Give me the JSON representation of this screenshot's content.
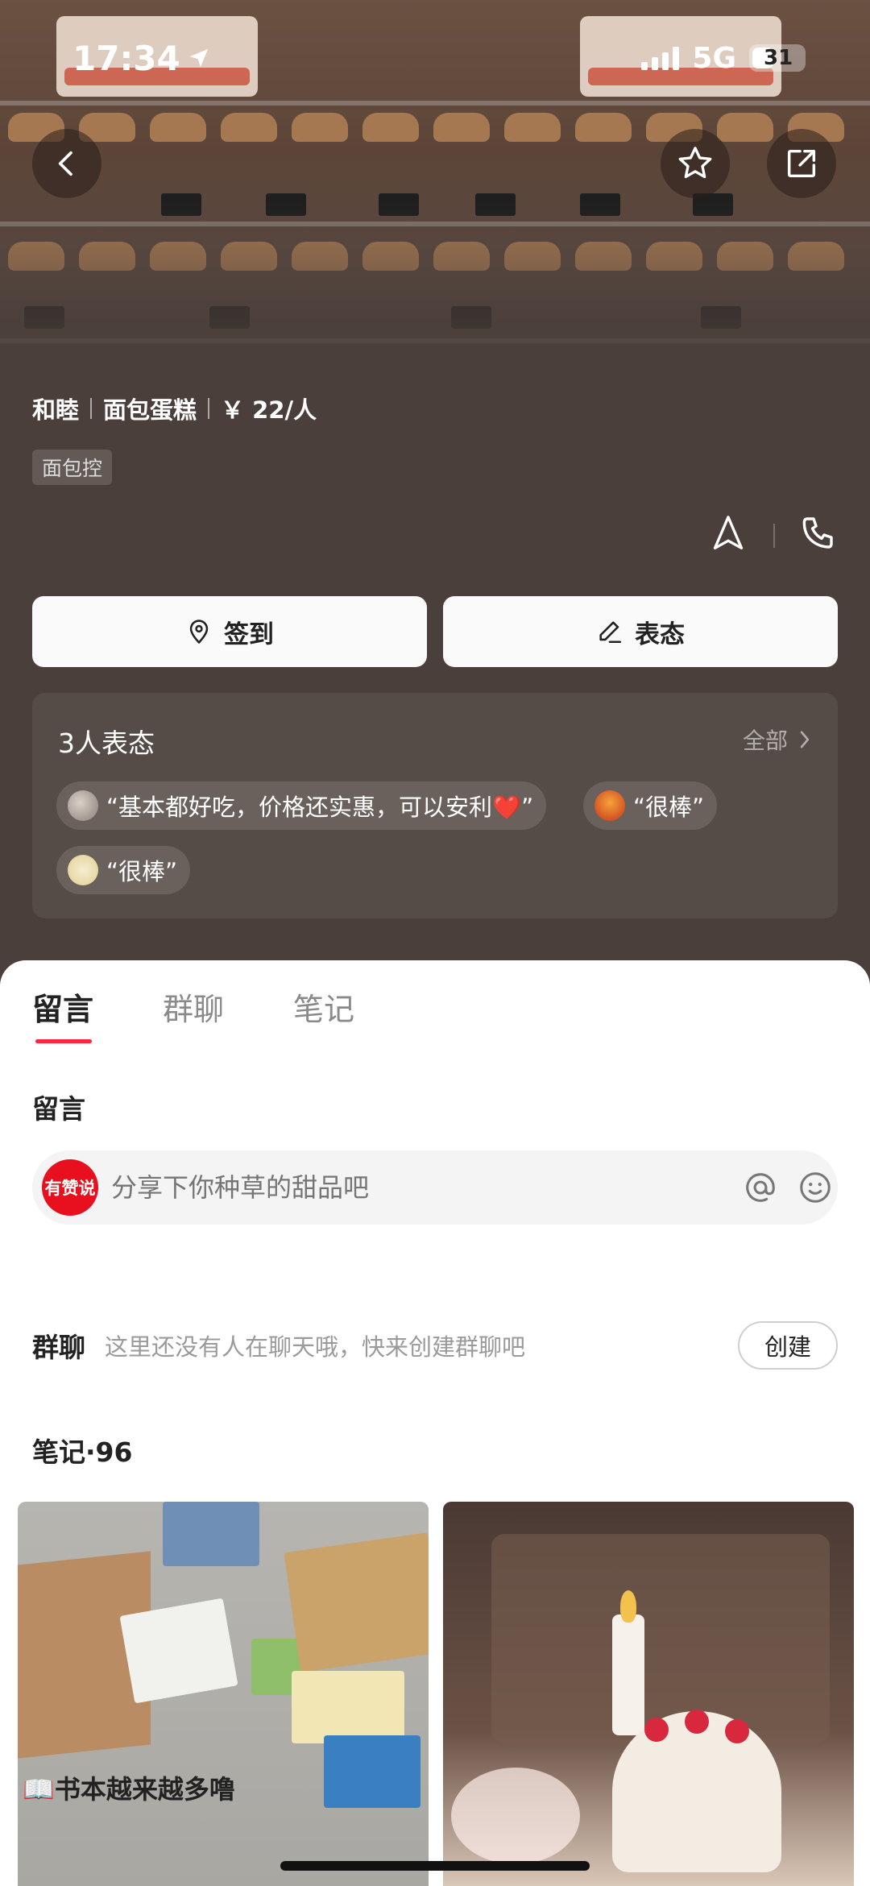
{
  "status_bar": {
    "time": "17:34",
    "network": "5G",
    "battery": "31"
  },
  "shop": {
    "name": "和睦",
    "category": "面包蛋糕",
    "price": "￥ 22/人",
    "badge": "面包控"
  },
  "actions": {
    "checkin_label": "签到",
    "opinion_label": "表态"
  },
  "reviews": {
    "title": "3人表态",
    "all_label": "全部",
    "chips": [
      {
        "text": "“基本都好吃，价格还实惠，可以安利❤️”"
      },
      {
        "text": "“很棒”"
      },
      {
        "text": "“很棒”"
      }
    ]
  },
  "tabs": [
    {
      "label": "留言",
      "active": true
    },
    {
      "label": "群聊",
      "active": false
    },
    {
      "label": "笔记",
      "active": false
    }
  ],
  "comments": {
    "section_label": "留言",
    "brand_label": "有赞说",
    "placeholder": "分享下你种草的甜品吧"
  },
  "group_chat": {
    "label": "群聊",
    "hint": "这里还没有人在聊天哦，快来创建群聊吧",
    "create_label": "创建"
  },
  "notes": {
    "title": "笔记·96",
    "cards": [
      {
        "caption": "📖书本越来越多噜"
      },
      {
        "caption": ""
      }
    ]
  }
}
